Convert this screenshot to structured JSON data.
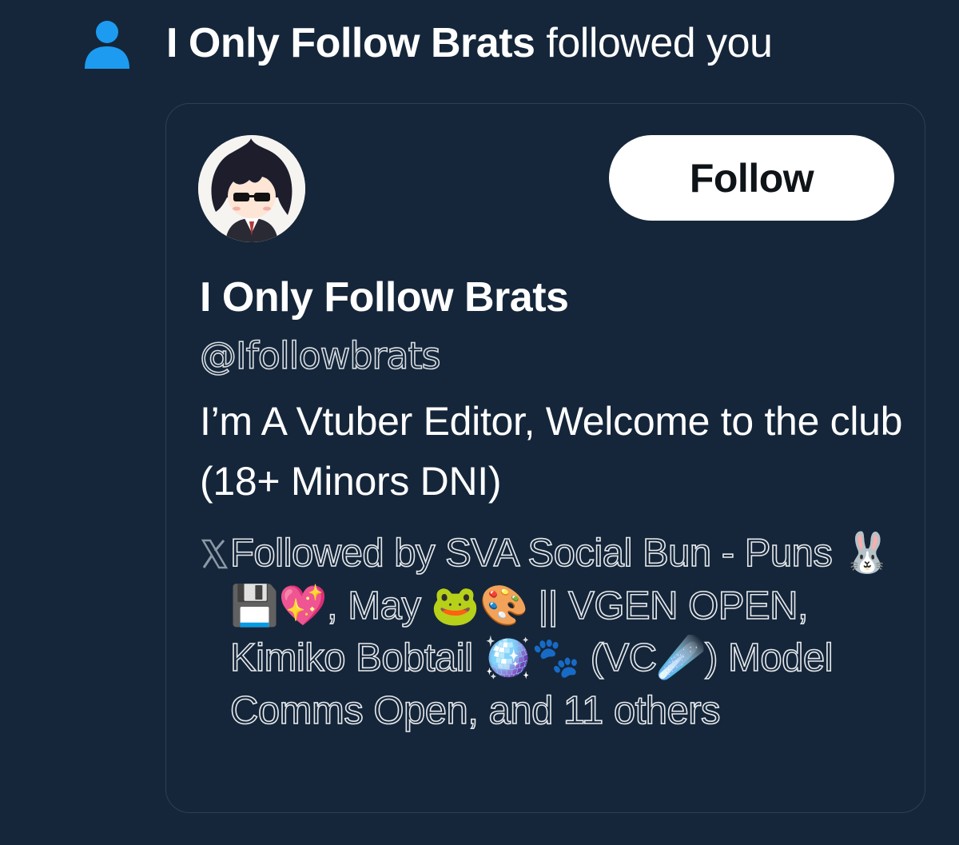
{
  "notification": {
    "icon": "person-icon",
    "actor_name": "I Only Follow Brats",
    "action_text": " followed you",
    "accent_color": "#1d9bf0"
  },
  "card": {
    "avatar_alt": "profile avatar",
    "follow_button_label": "Follow",
    "display_name": "I Only Follow Brats",
    "handle": "@Ifollowbrats",
    "bio": "I’m A Vtuber Editor, Welcome to the club (18+ Minors DNI)",
    "followed_by_icon": "x-logo-icon",
    "followed_by_text": "Followed by SVA Social Bun - Puns 🐰💾💖, May 🐸🎨 || VGEN OPEN, Kimiko Bobtail 🪩🐾 (VC☄️) Model Comms Open, and 11 others"
  },
  "colors": {
    "background": "#15263a",
    "card_border": "#2d3f53",
    "button_bg": "#ffffff",
    "button_text": "#0f1419",
    "text": "#ffffff"
  }
}
